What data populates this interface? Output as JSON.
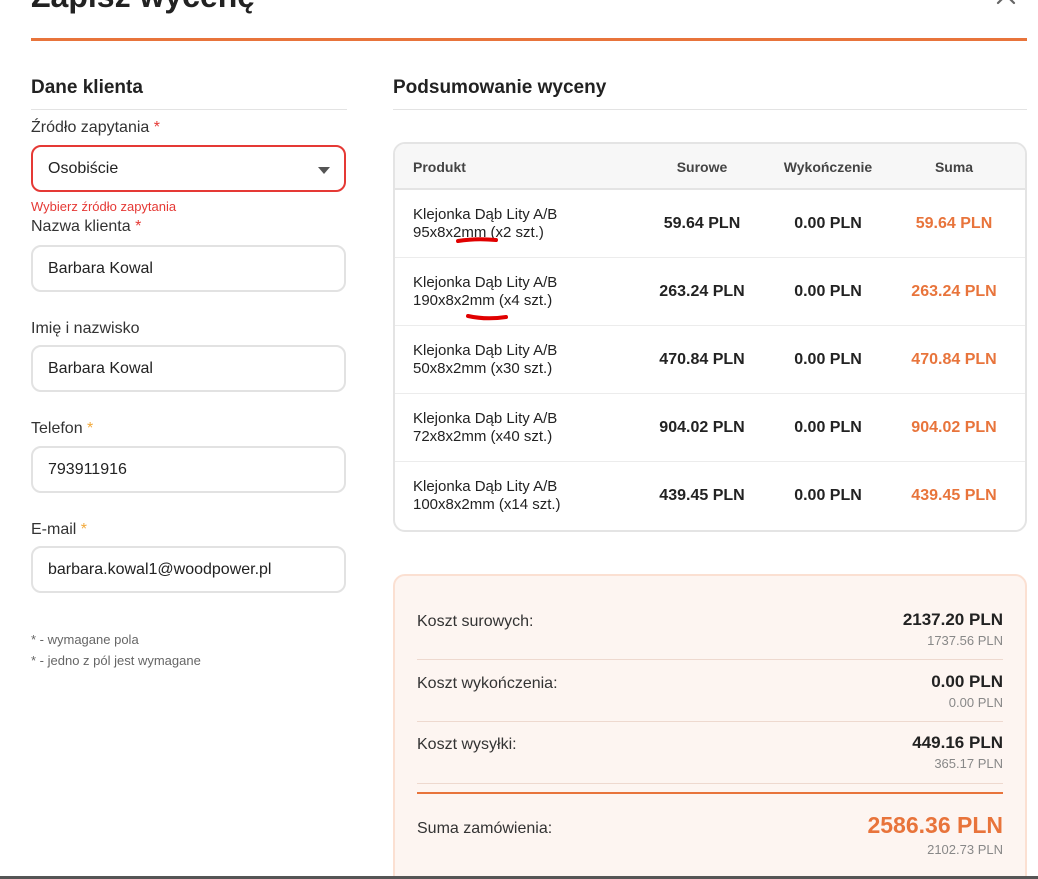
{
  "modal": {
    "title": "Zapisz wycenę"
  },
  "client": {
    "section_title": "Dane klienta",
    "source_label": "Źródło zapytania",
    "source_required": "*",
    "source_value": "Osobiście",
    "source_error": "Wybierz źródło zapytania",
    "client_name_label": "Nazwa klienta",
    "client_name_required": "*",
    "client_name_value": "Barbara Kowal",
    "full_name_label": "Imię i nazwisko",
    "full_name_value": "Barbara Kowal",
    "phone_label": "Telefon",
    "phone_required": "*",
    "phone_value": "793911916",
    "email_label": "E-mail",
    "email_required": "*",
    "email_value": "barbara.kowal1@woodpower.pl",
    "note_required": "* - wymagane pola",
    "note_one_of": "* - jedno z pól jest wymagane"
  },
  "summary": {
    "section_title": "Podsumowanie wyceny",
    "columns": [
      "Produkt",
      "Surowe",
      "Wykończenie",
      "Suma"
    ],
    "products": [
      {
        "name": "Klejonka Dąb Lity A/B",
        "dims": "95x8x2mm (x2 szt.)",
        "raw": "59.64 PLN",
        "finish": "0.00 PLN",
        "total": "59.64 PLN"
      },
      {
        "name": "Klejonka Dąb Lity A/B",
        "dims": "190x8x2mm (x4 szt.)",
        "raw": "263.24 PLN",
        "finish": "0.00 PLN",
        "total": "263.24 PLN"
      },
      {
        "name": "Klejonka Dąb Lity A/B",
        "dims": "50x8x2mm (x30 szt.)",
        "raw": "470.84 PLN",
        "finish": "0.00 PLN",
        "total": "470.84 PLN"
      },
      {
        "name": "Klejonka Dąb Lity A/B",
        "dims": "72x8x2mm (x40 szt.)",
        "raw": "904.02 PLN",
        "finish": "0.00 PLN",
        "total": "904.02 PLN"
      },
      {
        "name": "Klejonka Dąb Lity A/B",
        "dims": "100x8x2mm (x14 szt.)",
        "raw": "439.45 PLN",
        "finish": "0.00 PLN",
        "total": "439.45 PLN"
      }
    ],
    "costs": {
      "raw_label": "Koszt surowych:",
      "raw_value": "2137.20 PLN",
      "raw_net": "1737.56 PLN",
      "finish_label": "Koszt wykończenia:",
      "finish_value": "0.00 PLN",
      "finish_net": "0.00 PLN",
      "shipping_label": "Koszt wysyłki:",
      "shipping_value": "449.16 PLN",
      "shipping_net": "365.17 PLN",
      "total_label": "Suma zamówienia:",
      "total_value": "2586.36 PLN",
      "total_net": "2102.73 PLN"
    }
  },
  "colors": {
    "accent": "#e8743b",
    "error": "#e53935",
    "required_yellow": "#f2a93b",
    "summary_bg": "#fdf5f1"
  }
}
